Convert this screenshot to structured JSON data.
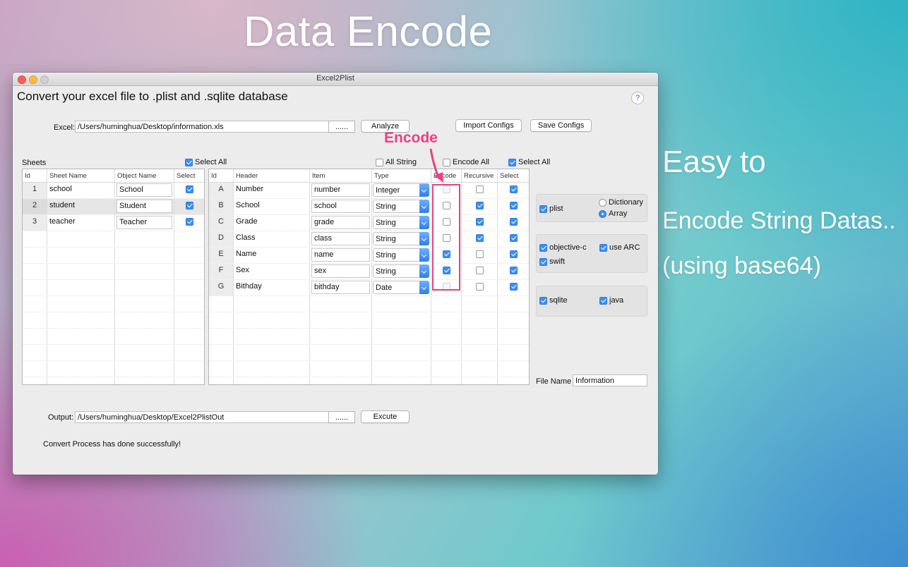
{
  "hero": {
    "title": "Data Encode"
  },
  "side": {
    "line1": "Easy to",
    "line2": "Encode String Datas..",
    "line3": "(using base64)"
  },
  "window": {
    "title": "Excel2Plist"
  },
  "header": {
    "heading": "Convert your excel file to .plist and .sqlite database",
    "help": "?"
  },
  "excel": {
    "label": "Excel:",
    "path": "/Users/huminghua/Desktop/information.xls",
    "browse": "......",
    "analyze": "Analyze",
    "import": "Import Configs",
    "save": "Save Configs"
  },
  "sheets": {
    "label": "Sheets",
    "select_all": "Select All",
    "columns": [
      "Id",
      "Sheet Name",
      "Object Name",
      "Select"
    ],
    "rows": [
      {
        "id": "1",
        "name": "school",
        "object": "School",
        "select": true
      },
      {
        "id": "2",
        "name": "student",
        "object": "Student",
        "select": true
      },
      {
        "id": "3",
        "name": "teacher",
        "object": "Teacher",
        "select": true
      }
    ]
  },
  "fields": {
    "all_string": "All String",
    "encode_all": "Encode All",
    "select_all": "Select All",
    "columns": [
      "Id",
      "Header",
      "Item",
      "Type",
      "Encode",
      "Recursive",
      "Select"
    ],
    "rows": [
      {
        "id": "A",
        "header": "Number",
        "item": "number",
        "type": "Integer",
        "encode": false,
        "encode_disabled": true,
        "recursive": false,
        "select": true
      },
      {
        "id": "B",
        "header": "School",
        "item": "school",
        "type": "String",
        "encode": false,
        "encode_disabled": false,
        "recursive": true,
        "select": true
      },
      {
        "id": "C",
        "header": "Grade",
        "item": "grade",
        "type": "String",
        "encode": false,
        "encode_disabled": false,
        "recursive": true,
        "select": true
      },
      {
        "id": "D",
        "header": "Class",
        "item": "class",
        "type": "String",
        "encode": false,
        "encode_disabled": false,
        "recursive": true,
        "select": true
      },
      {
        "id": "E",
        "header": "Name",
        "item": "name",
        "type": "String",
        "encode": true,
        "encode_disabled": false,
        "recursive": false,
        "select": true
      },
      {
        "id": "F",
        "header": "Sex",
        "item": "sex",
        "type": "String",
        "encode": true,
        "encode_disabled": false,
        "recursive": false,
        "select": true
      },
      {
        "id": "G",
        "header": "Bithday",
        "item": "bithday",
        "type": "Date",
        "encode": false,
        "encode_disabled": true,
        "recursive": false,
        "select": true
      }
    ]
  },
  "options": {
    "plist": "plist",
    "dictionary": "Dictionary",
    "array": "Array",
    "objc": "objective-c",
    "use_arc": "use ARC",
    "swift": "swift",
    "sqlite": "sqlite",
    "java": "java"
  },
  "file_name": {
    "label": "File Name",
    "value": "Information"
  },
  "output": {
    "label": "Output:",
    "path": "/Users/huminghua/Desktop/Excel2PlistOut",
    "browse": "......",
    "execute": "Excute"
  },
  "status": "Convert Process has done successfully!",
  "annotation": {
    "label": "Encode",
    "color": "#ec3f86"
  }
}
